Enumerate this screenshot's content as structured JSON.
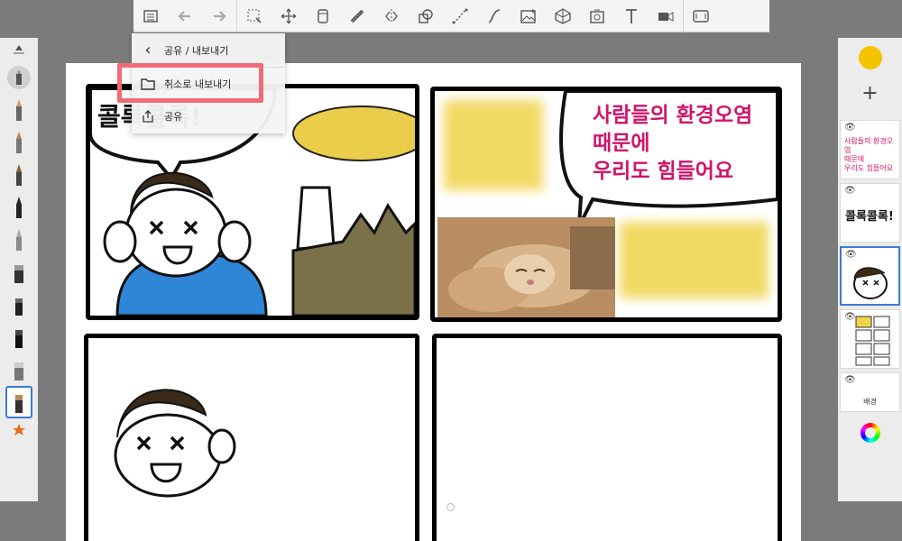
{
  "toolbar": {
    "icons": [
      "list-icon",
      "undo-icon",
      "redo-icon",
      "select-icon",
      "move-icon",
      "layer-icon",
      "ruler-icon",
      "symmetry-icon",
      "shape-icon",
      "curve-icon",
      "stroke-icon",
      "image-icon",
      "perspective-icon",
      "timer-icon",
      "text-icon",
      "video-icon",
      "fullscreen-icon"
    ]
  },
  "popup": {
    "title": "공유 / 내보내기",
    "items": [
      {
        "label": "취소로 내보내기",
        "icon": "folder-icon",
        "highlighted": true
      },
      {
        "label": "공유",
        "icon": "share-icon"
      }
    ]
  },
  "canvas": {
    "panel1_text": "콜록콜록!",
    "panel2_speech": [
      "사람들의 환경오염",
      "때문에",
      "우리도 힘들어요"
    ]
  },
  "layers": {
    "color": "#f5c400",
    "add_label": "+",
    "items": [
      {
        "type": "text",
        "lines": [
          "사람들의 환경오염",
          "때문에",
          "우리도 힘들어요"
        ]
      },
      {
        "type": "text-bold",
        "lines": [
          "콜록콜록!"
        ]
      },
      {
        "type": "drawing",
        "selected": true
      },
      {
        "type": "grid"
      },
      {
        "type": "background",
        "label": "배경"
      }
    ]
  },
  "colors": {
    "accent": "#3a7bd5",
    "highlight": "#f06b78",
    "speech": "#d0156b",
    "yellow": "#f5c400"
  }
}
